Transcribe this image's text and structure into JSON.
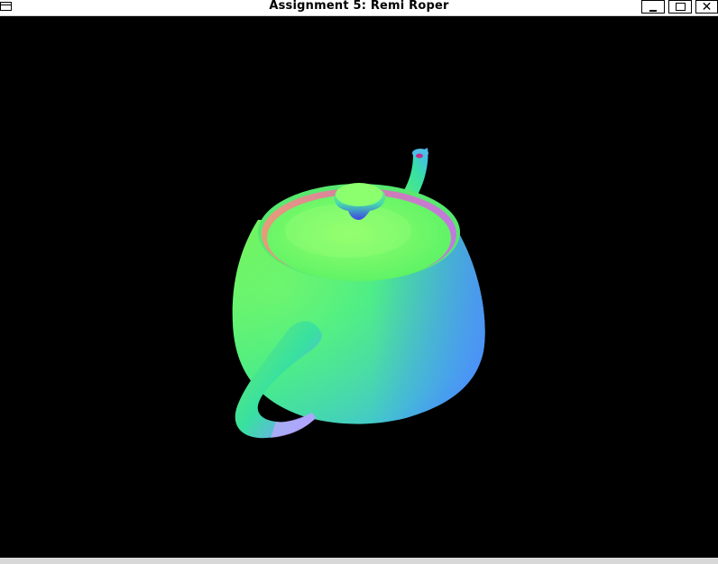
{
  "window": {
    "title": "Assignment 5: Remi Roper",
    "buttons": {
      "minimize": "minimize-icon",
      "maximize": "maximize-icon",
      "close": "close-icon"
    }
  },
  "viewport": {
    "background": "#000000",
    "object": "teapot-render",
    "shading": "normal-map",
    "colors": {
      "top": "#8cff70",
      "side": "#38e8a6",
      "right": "#4aa8ff",
      "underside": "#7a5cff",
      "rim": "#e08a88"
    }
  }
}
